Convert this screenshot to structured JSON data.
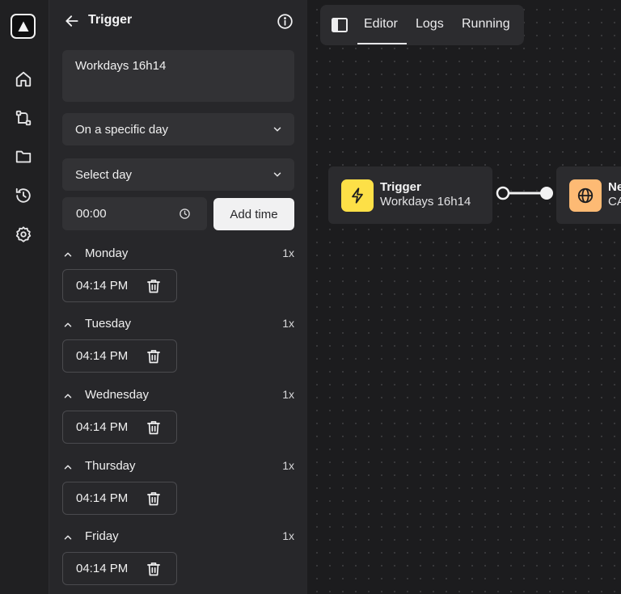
{
  "rail": {
    "logo": "logo-icon",
    "items": [
      {
        "icon": "home-icon"
      },
      {
        "icon": "workflow-icon"
      },
      {
        "icon": "folder-icon"
      },
      {
        "icon": "history-icon"
      },
      {
        "icon": "settings-icon"
      }
    ]
  },
  "panel": {
    "title": "Trigger",
    "name_value": "Workdays 16h14",
    "frequency_select": "On a specific day",
    "day_select_placeholder": "Select day",
    "time_input_value": "00:00",
    "add_time_label": "Add time",
    "days": [
      {
        "name": "Monday",
        "count": "1x",
        "times": [
          "04:14 PM"
        ]
      },
      {
        "name": "Tuesday",
        "count": "1x",
        "times": [
          "04:14 PM"
        ]
      },
      {
        "name": "Wednesday",
        "count": "1x",
        "times": [
          "04:14 PM"
        ]
      },
      {
        "name": "Thursday",
        "count": "1x",
        "times": [
          "04:14 PM"
        ]
      },
      {
        "name": "Friday",
        "count": "1x",
        "times": [
          "04:14 PM"
        ]
      }
    ]
  },
  "canvas": {
    "tabs": [
      {
        "label": "Editor",
        "active": true
      },
      {
        "label": "Logs",
        "active": false
      },
      {
        "label": "Running",
        "active": false
      }
    ],
    "nodes": [
      {
        "title": "Trigger",
        "subtitle": "Workdays 16h14",
        "icon": "lightning-icon",
        "color": "#fde047"
      },
      {
        "title": "Ne",
        "subtitle": "CA",
        "icon": "globe-icon",
        "color": "#fdba74"
      }
    ]
  },
  "colors": {
    "rail_bg": "#202022",
    "panel_bg": "#27272a",
    "field_bg": "#323235",
    "canvas_bg": "#1c1c1e",
    "trigger_accent": "#fde047",
    "http_accent": "#fdba74"
  }
}
